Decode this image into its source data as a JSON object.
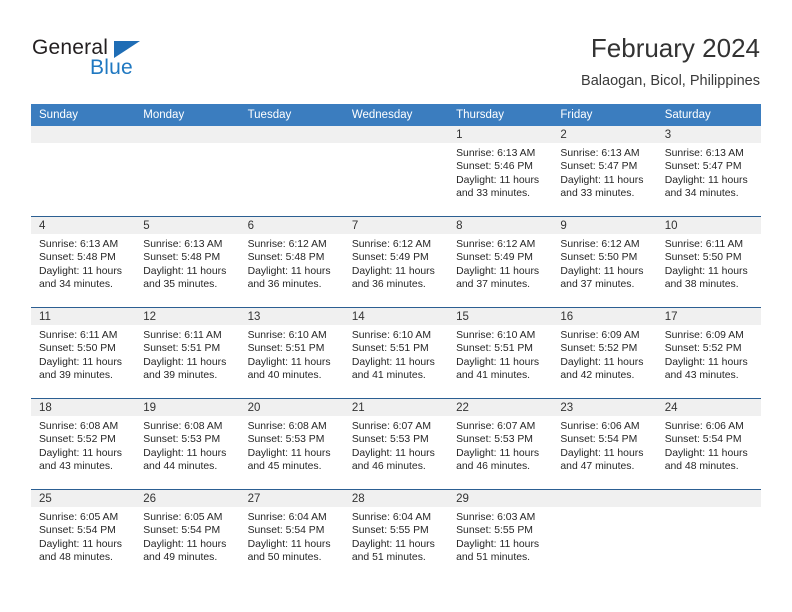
{
  "brand": {
    "name_part1": "General",
    "name_part2": "Blue",
    "triangle_icon": "triangle-icon",
    "colors": {
      "dark": "#231f20",
      "blue": "#1f78c1"
    }
  },
  "header": {
    "title": "February 2024",
    "subtitle": "Balaogan, Bicol, Philippines"
  },
  "calendar": {
    "header_bg": "#3b7dbf",
    "daynum_bg": "#f0f0f0",
    "row_rule": "#2c5f92",
    "weekday_headers": [
      "Sunday",
      "Monday",
      "Tuesday",
      "Wednesday",
      "Thursday",
      "Friday",
      "Saturday"
    ],
    "weeks": [
      [
        {
          "empty": true
        },
        {
          "empty": true
        },
        {
          "empty": true
        },
        {
          "empty": true
        },
        {
          "day": "1",
          "sunrise": "Sunrise: 6:13 AM",
          "sunset": "Sunset: 5:46 PM",
          "daylight_line1": "Daylight: 11 hours",
          "daylight_line2": "and 33 minutes."
        },
        {
          "day": "2",
          "sunrise": "Sunrise: 6:13 AM",
          "sunset": "Sunset: 5:47 PM",
          "daylight_line1": "Daylight: 11 hours",
          "daylight_line2": "and 33 minutes."
        },
        {
          "day": "3",
          "sunrise": "Sunrise: 6:13 AM",
          "sunset": "Sunset: 5:47 PM",
          "daylight_line1": "Daylight: 11 hours",
          "daylight_line2": "and 34 minutes."
        }
      ],
      [
        {
          "day": "4",
          "sunrise": "Sunrise: 6:13 AM",
          "sunset": "Sunset: 5:48 PM",
          "daylight_line1": "Daylight: 11 hours",
          "daylight_line2": "and 34 minutes."
        },
        {
          "day": "5",
          "sunrise": "Sunrise: 6:13 AM",
          "sunset": "Sunset: 5:48 PM",
          "daylight_line1": "Daylight: 11 hours",
          "daylight_line2": "and 35 minutes."
        },
        {
          "day": "6",
          "sunrise": "Sunrise: 6:12 AM",
          "sunset": "Sunset: 5:48 PM",
          "daylight_line1": "Daylight: 11 hours",
          "daylight_line2": "and 36 minutes."
        },
        {
          "day": "7",
          "sunrise": "Sunrise: 6:12 AM",
          "sunset": "Sunset: 5:49 PM",
          "daylight_line1": "Daylight: 11 hours",
          "daylight_line2": "and 36 minutes."
        },
        {
          "day": "8",
          "sunrise": "Sunrise: 6:12 AM",
          "sunset": "Sunset: 5:49 PM",
          "daylight_line1": "Daylight: 11 hours",
          "daylight_line2": "and 37 minutes."
        },
        {
          "day": "9",
          "sunrise": "Sunrise: 6:12 AM",
          "sunset": "Sunset: 5:50 PM",
          "daylight_line1": "Daylight: 11 hours",
          "daylight_line2": "and 37 minutes."
        },
        {
          "day": "10",
          "sunrise": "Sunrise: 6:11 AM",
          "sunset": "Sunset: 5:50 PM",
          "daylight_line1": "Daylight: 11 hours",
          "daylight_line2": "and 38 minutes."
        }
      ],
      [
        {
          "day": "11",
          "sunrise": "Sunrise: 6:11 AM",
          "sunset": "Sunset: 5:50 PM",
          "daylight_line1": "Daylight: 11 hours",
          "daylight_line2": "and 39 minutes."
        },
        {
          "day": "12",
          "sunrise": "Sunrise: 6:11 AM",
          "sunset": "Sunset: 5:51 PM",
          "daylight_line1": "Daylight: 11 hours",
          "daylight_line2": "and 39 minutes."
        },
        {
          "day": "13",
          "sunrise": "Sunrise: 6:10 AM",
          "sunset": "Sunset: 5:51 PM",
          "daylight_line1": "Daylight: 11 hours",
          "daylight_line2": "and 40 minutes."
        },
        {
          "day": "14",
          "sunrise": "Sunrise: 6:10 AM",
          "sunset": "Sunset: 5:51 PM",
          "daylight_line1": "Daylight: 11 hours",
          "daylight_line2": "and 41 minutes."
        },
        {
          "day": "15",
          "sunrise": "Sunrise: 6:10 AM",
          "sunset": "Sunset: 5:51 PM",
          "daylight_line1": "Daylight: 11 hours",
          "daylight_line2": "and 41 minutes."
        },
        {
          "day": "16",
          "sunrise": "Sunrise: 6:09 AM",
          "sunset": "Sunset: 5:52 PM",
          "daylight_line1": "Daylight: 11 hours",
          "daylight_line2": "and 42 minutes."
        },
        {
          "day": "17",
          "sunrise": "Sunrise: 6:09 AM",
          "sunset": "Sunset: 5:52 PM",
          "daylight_line1": "Daylight: 11 hours",
          "daylight_line2": "and 43 minutes."
        }
      ],
      [
        {
          "day": "18",
          "sunrise": "Sunrise: 6:08 AM",
          "sunset": "Sunset: 5:52 PM",
          "daylight_line1": "Daylight: 11 hours",
          "daylight_line2": "and 43 minutes."
        },
        {
          "day": "19",
          "sunrise": "Sunrise: 6:08 AM",
          "sunset": "Sunset: 5:53 PM",
          "daylight_line1": "Daylight: 11 hours",
          "daylight_line2": "and 44 minutes."
        },
        {
          "day": "20",
          "sunrise": "Sunrise: 6:08 AM",
          "sunset": "Sunset: 5:53 PM",
          "daylight_line1": "Daylight: 11 hours",
          "daylight_line2": "and 45 minutes."
        },
        {
          "day": "21",
          "sunrise": "Sunrise: 6:07 AM",
          "sunset": "Sunset: 5:53 PM",
          "daylight_line1": "Daylight: 11 hours",
          "daylight_line2": "and 46 minutes."
        },
        {
          "day": "22",
          "sunrise": "Sunrise: 6:07 AM",
          "sunset": "Sunset: 5:53 PM",
          "daylight_line1": "Daylight: 11 hours",
          "daylight_line2": "and 46 minutes."
        },
        {
          "day": "23",
          "sunrise": "Sunrise: 6:06 AM",
          "sunset": "Sunset: 5:54 PM",
          "daylight_line1": "Daylight: 11 hours",
          "daylight_line2": "and 47 minutes."
        },
        {
          "day": "24",
          "sunrise": "Sunrise: 6:06 AM",
          "sunset": "Sunset: 5:54 PM",
          "daylight_line1": "Daylight: 11 hours",
          "daylight_line2": "and 48 minutes."
        }
      ],
      [
        {
          "day": "25",
          "sunrise": "Sunrise: 6:05 AM",
          "sunset": "Sunset: 5:54 PM",
          "daylight_line1": "Daylight: 11 hours",
          "daylight_line2": "and 48 minutes."
        },
        {
          "day": "26",
          "sunrise": "Sunrise: 6:05 AM",
          "sunset": "Sunset: 5:54 PM",
          "daylight_line1": "Daylight: 11 hours",
          "daylight_line2": "and 49 minutes."
        },
        {
          "day": "27",
          "sunrise": "Sunrise: 6:04 AM",
          "sunset": "Sunset: 5:54 PM",
          "daylight_line1": "Daylight: 11 hours",
          "daylight_line2": "and 50 minutes."
        },
        {
          "day": "28",
          "sunrise": "Sunrise: 6:04 AM",
          "sunset": "Sunset: 5:55 PM",
          "daylight_line1": "Daylight: 11 hours",
          "daylight_line2": "and 51 minutes."
        },
        {
          "day": "29",
          "sunrise": "Sunrise: 6:03 AM",
          "sunset": "Sunset: 5:55 PM",
          "daylight_line1": "Daylight: 11 hours",
          "daylight_line2": "and 51 minutes."
        },
        {
          "empty": true
        },
        {
          "empty": true
        }
      ]
    ]
  }
}
